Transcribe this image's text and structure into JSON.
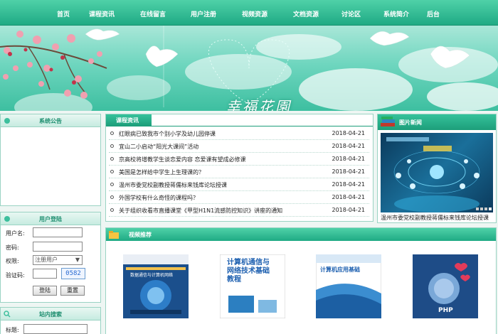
{
  "nav": {
    "items": [
      "首页",
      "课程资讯",
      "在线留言",
      "用户注册",
      "视频资源",
      "文档资源",
      "讨论区",
      "系统简介",
      "后台"
    ]
  },
  "banner": {
    "logo_text": "幸福花園"
  },
  "notice_panel": {
    "title": "系统公告"
  },
  "news_panel": {
    "title": "课程资讯",
    "items": [
      {
        "title": "红眼病已致我市个别小学及幼儿园停课",
        "date": "2018-04-21"
      },
      {
        "title": "宜山二小启动“阳光大课间”活动",
        "date": "2018-04-21"
      },
      {
        "title": "京高校将增教学生谈恋爱内容 恋爱课有望成必修课",
        "date": "2018-04-21"
      },
      {
        "title": "美国是怎样给中学生上生理课的？",
        "date": "2018-04-21"
      },
      {
        "title": "温州市委党校副教授蒋儒标来钱库论坛授课",
        "date": "2018-04-21"
      },
      {
        "title": "外国学校有什么奇怪的课程吗？",
        "date": "2018-04-21"
      },
      {
        "title": "关于组织收看市直播课堂《甲型H1N1流感防控知识》讲座的通知",
        "date": "2018-04-21"
      }
    ]
  },
  "picture_panel": {
    "title": "图片新闻",
    "caption": "温州市委党校副教授蒋儒标来钱库论坛授课"
  },
  "login_panel": {
    "title": "用户登陆",
    "username_label": "用户名:",
    "password_label": "密码:",
    "role_label": "权限:",
    "role_selected": "注册用户",
    "captcha_label": "验证码:",
    "captcha_code": "0582",
    "login_button": "登陆",
    "reset_button": "重置"
  },
  "search_panel": {
    "title": "站内搜索",
    "keyword_label": "标题:"
  },
  "video_panel": {
    "title": "视频推荐",
    "books": [
      {
        "title": "数据通信与计算机网络"
      },
      {
        "title": "计算机通信与网络技术基础教程"
      },
      {
        "title": "计算机应用基础"
      },
      {
        "title": "PHP"
      }
    ]
  },
  "colors": {
    "nav": "#1faa84",
    "accent": "#1f8f70",
    "panel_border": "#9ad3c3"
  }
}
